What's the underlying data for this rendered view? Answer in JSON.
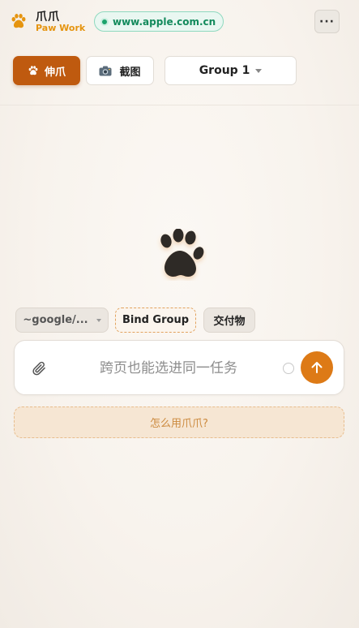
{
  "header": {
    "brand_title": "爪爪",
    "brand_subtitle": "Paw Work",
    "url": "www.apple.com.cn",
    "more_label": "···",
    "logo_icon": "paw-icon"
  },
  "toolbar": {
    "claw_label": "伸爪",
    "claw_icon": "paw-icon",
    "screenshot_label": "截图",
    "screenshot_icon": "camera-icon",
    "group_selected": "Group 1"
  },
  "chips": {
    "path_label": "~google/...",
    "bind_group_label": "Bind Group",
    "deliverable_label": "交付物"
  },
  "composer": {
    "placeholder": "跨页也能选进同一任务",
    "value": "",
    "send_icon": "arrow-up-icon",
    "attach_icon": "paperclip-icon"
  },
  "howto": {
    "label": "怎么用爪爪?"
  },
  "colors": {
    "accent": "#dd7a16",
    "claw_button": "#bf5a0f",
    "brand_sub": "#e5940f",
    "url_green": "#138a5c",
    "background": "#f7f2ec"
  }
}
